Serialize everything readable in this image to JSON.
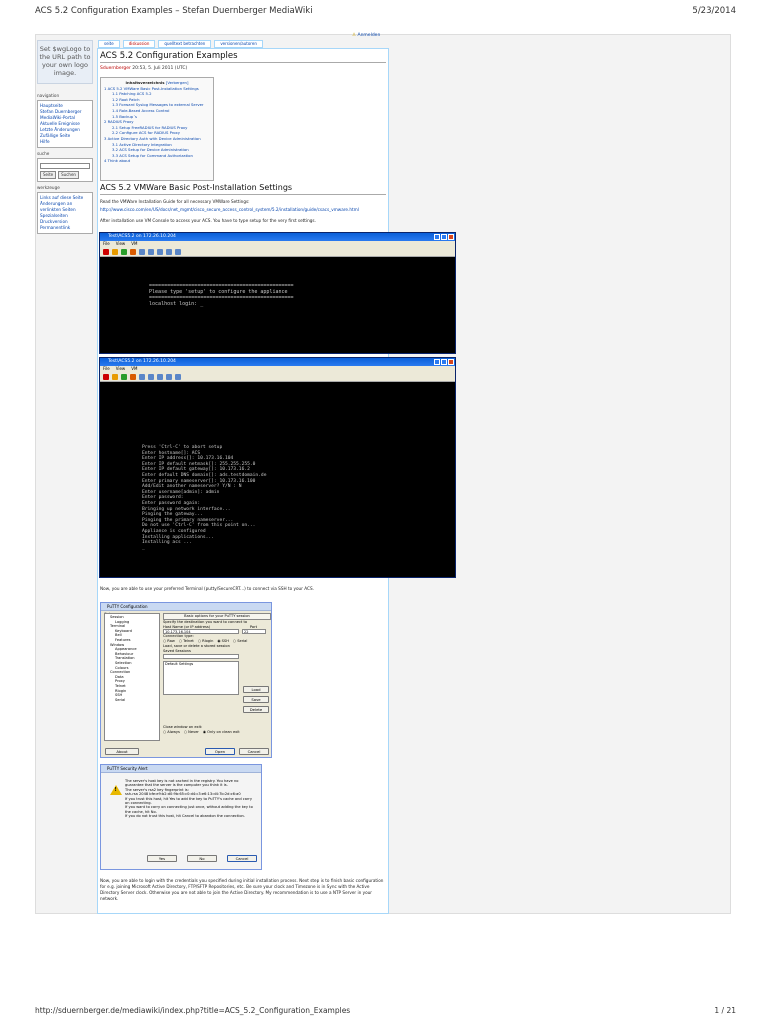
{
  "print": {
    "title": "ACS 5.2 Configuration Examples – Stefan Duernberger MediaWiki",
    "date": "5/23/2014",
    "url": "http://sduernberger.de/mediawiki/index.php?title=ACS_5.2_Configuration_Examples",
    "page": "1 / 21"
  },
  "logo_text": "Set $wgLogo to the URL path to your own logo image.",
  "login_label": "Anmelden",
  "tabs": [
    "seite",
    "diskussion",
    "quelltext betrachten",
    "versionen/autoren"
  ],
  "sidebar": {
    "navigation_title": "navigation",
    "navigation": [
      "Hauptseite",
      "Stefan Duernberger MediaWiki-Portal",
      "Aktuelle Ereignisse",
      "Letzte Änderungen",
      "Zufällige Seite",
      "Hilfe"
    ],
    "search_title": "suche",
    "search_buttons": [
      "Seite",
      "Suchen"
    ],
    "tools_title": "werkzeuge",
    "tools": [
      "Links auf diese Seite",
      "Änderungen an verlinkten Seiten",
      "Spezialseiten",
      "Druckversion",
      "Permanentlink"
    ]
  },
  "page": {
    "title": "ACS 5.2 Configuration Examples",
    "byline_user": "Sduernberger",
    "byline_date": "20:53, 5. Juli 2011 (UTC)"
  },
  "toc": {
    "title": "Inhaltsverzeichnis",
    "toggle": "[Verbergen]",
    "entries": [
      {
        "level": 1,
        "text": "1 ACS 5.2 VMWare Basic Post-Installation Settings"
      },
      {
        "level": 2,
        "text": "1.1 Patching ACS 5.2"
      },
      {
        "level": 2,
        "text": "1.2 Root Patch"
      },
      {
        "level": 2,
        "text": "1.3 Forward Syslog Messages to external Server"
      },
      {
        "level": 2,
        "text": "1.4 Role-Based Access Control"
      },
      {
        "level": 2,
        "text": "1.5 Backup´s"
      },
      {
        "level": 1,
        "text": "2 RADIUS Proxy"
      },
      {
        "level": 2,
        "text": "2.1 Setup FreeRADIUS for RADIUS Proxy"
      },
      {
        "level": 2,
        "text": "2.2 Configure ACS for RADIUS Proxy"
      },
      {
        "level": 1,
        "text": "3 Active Directory Auth with Device Administration"
      },
      {
        "level": 2,
        "text": "3.1 Active Directory Integration"
      },
      {
        "level": 2,
        "text": "3.2 ACS Setup for Device Administration"
      },
      {
        "level": 2,
        "text": "3.3 ACS Setup for Command Authorization"
      },
      {
        "level": 1,
        "text": "4 Think about"
      }
    ]
  },
  "section1": {
    "heading": "ACS 5.2 VMWare Basic Post-Installation Settings",
    "intro": "Read the VMWare Installation Guide for all necessary VMWare Settings:",
    "link": "http://www.cisco.com/en/US/docs/net_mgmt/cisco_secure_access_control_system/5.2/installation/guide/csacs_vmware.html",
    "after_install": "After installation use VM Console to access your ACS. You have to type setup for the very first settings."
  },
  "vm_window": {
    "title": "Test\\ACS5.2 on 172.26.10.204",
    "menu": [
      "File",
      "View",
      "VM"
    ],
    "console1": "   ================================================\n   Please type 'setup' to configure the appliance\n   ================================================\n   localhost login: _",
    "console2": "Press 'Ctrl-C' to abort setup\nEnter hostname[]: ACS\nEnter IP address[]: 10.173.16.104\nEnter IP default netmask[]: 255.255.255.0\nEnter IP default gateway[]: 10.173.16.2\nEnter default DNS domain[]: ads.testdomain.de\nEnter primary nameserver[]: 10.173.16.100\nAdd/Edit another nameserver? Y/N : N\nEnter username[admin]: admin\nEnter password:\nEnter password again:\nBringing up network interface...\nPinging the gateway...\nPinging the primary nameserver...\nDo not use 'Ctrl-C' from this point on...\nAppliance is configured\nInstalling applications...\nInstalling acs ...\n_"
  },
  "section1b": {
    "putty_intro": "Now, you are able to use your preferred Terminal (putty/SecureCRT...) to connect via SSH to your ACS.",
    "closing": "Now, you are able to login with the credentials you specified during initial installation process. Next step is to finish basic configuration for e.g. joining Microsoft Active Directory, FTP/SFTP Repositories, etc. Be sure your clock and Timezone is in Sync with the Active Directory Server clock. Otherwise you are not able to join the Active Directory. My recommendation is to use a NTP Server in your network."
  },
  "putty": {
    "title": "PuTTY Configuration",
    "category_label": "Category:",
    "tree": [
      {
        "level": 0,
        "text": "Session"
      },
      {
        "level": 1,
        "text": "Logging"
      },
      {
        "level": 0,
        "text": "Terminal"
      },
      {
        "level": 1,
        "text": "Keyboard"
      },
      {
        "level": 1,
        "text": "Bell"
      },
      {
        "level": 1,
        "text": "Features"
      },
      {
        "level": 0,
        "text": "Window"
      },
      {
        "level": 1,
        "text": "Appearance"
      },
      {
        "level": 1,
        "text": "Behaviour"
      },
      {
        "level": 1,
        "text": "Translation"
      },
      {
        "level": 1,
        "text": "Selection"
      },
      {
        "level": 1,
        "text": "Colours"
      },
      {
        "level": 0,
        "text": "Connection"
      },
      {
        "level": 1,
        "text": "Data"
      },
      {
        "level": 1,
        "text": "Proxy"
      },
      {
        "level": 1,
        "text": "Telnet"
      },
      {
        "level": 1,
        "text": "Rlogin"
      },
      {
        "level": 1,
        "text": "SSH"
      },
      {
        "level": 1,
        "text": "Serial"
      }
    ],
    "panel_title": "Basic options for your PuTTY session",
    "dest_label": "Specify the destination you want to connect to",
    "host_label": "Host Name (or IP address)",
    "port_label": "Port",
    "host_value": "10.173.16.104",
    "port_value": "22",
    "conn_type_label": "Connection type:",
    "conn_types": [
      "Raw",
      "Telnet",
      "Rlogin",
      "SSH",
      "Serial"
    ],
    "selected_type": "SSH",
    "sessions_label": "Load, save or delete a stored session",
    "saved_sessions_label": "Saved Sessions",
    "sessions_list": [
      "Default Settings"
    ],
    "btn_load": "Load",
    "btn_save": "Save",
    "btn_delete": "Delete",
    "close_label": "Close window on exit:",
    "close_options": [
      "Always",
      "Never",
      "Only on clean exit"
    ],
    "close_selected": "Only on clean exit",
    "btn_about": "About",
    "btn_open": "Open",
    "btn_cancel": "Cancel"
  },
  "alert": {
    "title": "PuTTY Security Alert",
    "text": "The server's host key is not cached in the registry. You have no guarantee that the server is the computer you think it is.\nThe server's rsa2 key fingerprint is:\nssh-rsa 2048 bfe:e9:b2:d0:9b:65:c0:d4:c3:e6:13:d4:7b:2d:c6:a0\nIf you trust this host, hit Yes to add the key to PuTTY's cache and carry on connecting.\nIf you want to carry on connecting just once, without adding the key to the cache, hit No.\nIf you do not trust this host, hit Cancel to abandon the connection.",
    "btn_yes": "Yes",
    "btn_no": "No",
    "btn_cancel": "Cancel"
  },
  "colors": {
    "link": "#0645ad",
    "redlink": "#ba0000",
    "xp_title": "#0a5fd8",
    "dialog_bg": "#ece9d8"
  }
}
